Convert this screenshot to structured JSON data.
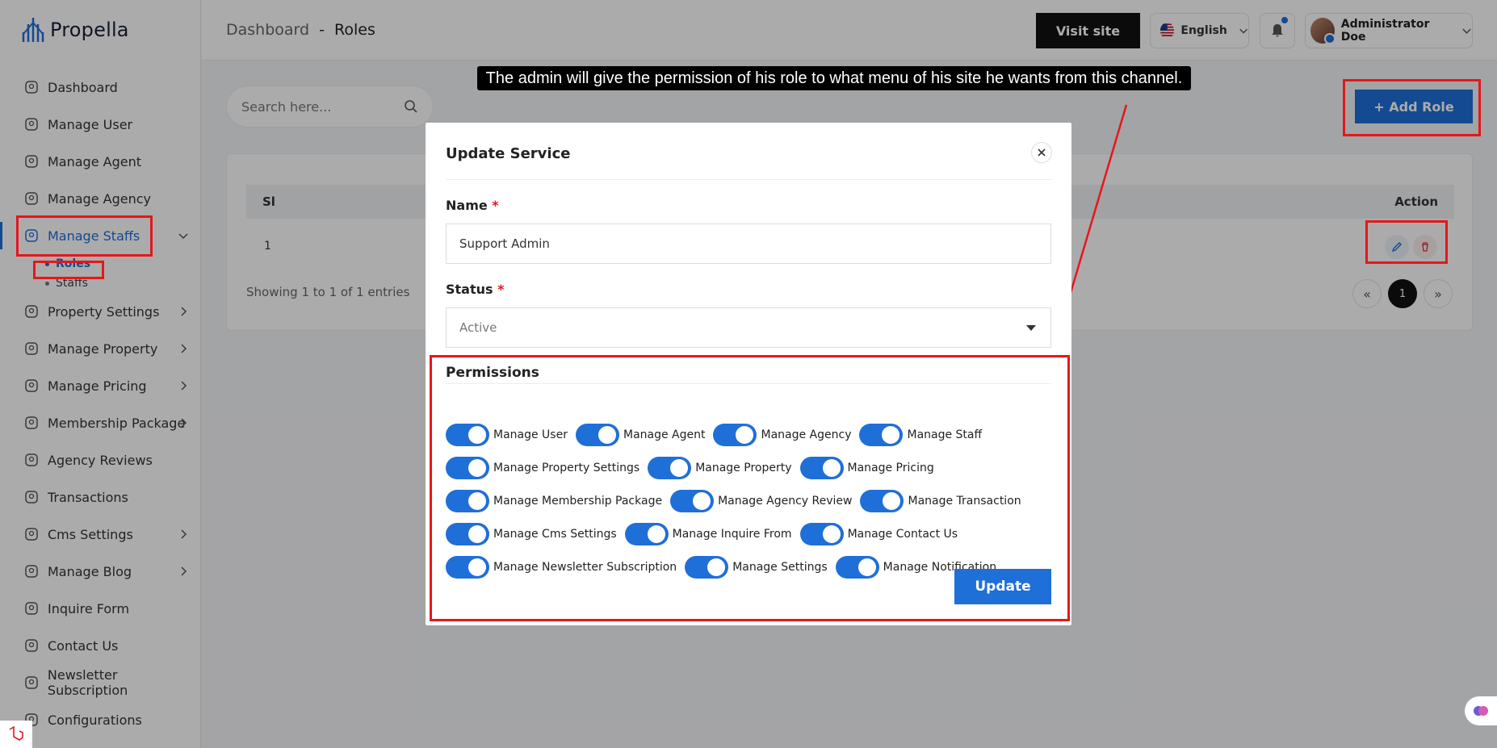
{
  "app": {
    "name": "Propella"
  },
  "sidebar": {
    "items": [
      {
        "label": "Dashboard",
        "icon": "grid-icon"
      },
      {
        "label": "Manage User",
        "icon": "user-circle-icon"
      },
      {
        "label": "Manage Agent",
        "icon": "person-icon"
      },
      {
        "label": "Manage Agency",
        "icon": "agency-icon"
      },
      {
        "label": "Manage Staffs",
        "icon": "users-icon",
        "active": true,
        "expanded": true
      },
      {
        "label": "Property Settings",
        "icon": "house-gear-icon"
      },
      {
        "label": "Manage Property",
        "icon": "building-gear-icon"
      },
      {
        "label": "Manage Pricing",
        "icon": "dollar-icon"
      },
      {
        "label": "Membership Package",
        "icon": "id-card-icon"
      },
      {
        "label": "Agency Reviews",
        "icon": "star-badge-icon"
      },
      {
        "label": "Transactions",
        "icon": "receipt-icon"
      },
      {
        "label": "Cms Settings",
        "icon": "gear-icon"
      },
      {
        "label": "Manage Blog",
        "icon": "blog-icon"
      },
      {
        "label": "Inquire Form",
        "icon": "list-icon"
      },
      {
        "label": "Contact Us",
        "icon": "contact-icon"
      },
      {
        "label": "Newsletter Subscription",
        "icon": "bell-icon"
      },
      {
        "label": "Configurations",
        "icon": "gear-icon"
      }
    ],
    "subitems": [
      {
        "label": "Roles",
        "active": true
      },
      {
        "label": "Staffs"
      }
    ]
  },
  "topbar": {
    "breadcrumb_root": "Dashboard",
    "breadcrumb_sep": "-",
    "breadcrumb_current": "Roles",
    "visit_site": "Visit site",
    "language": "English",
    "user_name": "Administrator Doe"
  },
  "content": {
    "search_placeholder": "Search here...",
    "add_role": "+ Add Role",
    "table": {
      "columns": [
        "Sl",
        "Action"
      ],
      "rows": [
        {
          "sl": "1"
        }
      ]
    },
    "showing": "Showing 1 to 1 of 1 entries",
    "pagination": {
      "prev": "«",
      "current": "1",
      "next": "»"
    }
  },
  "annotation": {
    "caption": "The admin will give the permission of his role to what menu of his site he wants from this channel."
  },
  "modal": {
    "title": "Update Service",
    "name_label": "Name",
    "name_value": "Support Admin",
    "status_label": "Status",
    "status_value": "Active",
    "required_mark": "*",
    "permissions_title": "Permissions",
    "permissions": [
      [
        "Manage User",
        "Manage Agent",
        "Manage Agency",
        "Manage Staff"
      ],
      [
        "Manage Property Settings",
        "Manage Property",
        "Manage Pricing"
      ],
      [
        "Manage Membership Package",
        "Manage Agency Review",
        "Manage Transaction"
      ],
      [
        "Manage Cms Settings",
        "Manage Inquire From",
        "Manage Contact Us"
      ],
      [
        "Manage Newsletter Subscription",
        "Manage Settings",
        "Manage Notification"
      ]
    ],
    "update_button": "Update"
  },
  "colors": {
    "primary": "#1f6fd8",
    "annotation_red": "#e5171b",
    "dark": "#111111"
  }
}
